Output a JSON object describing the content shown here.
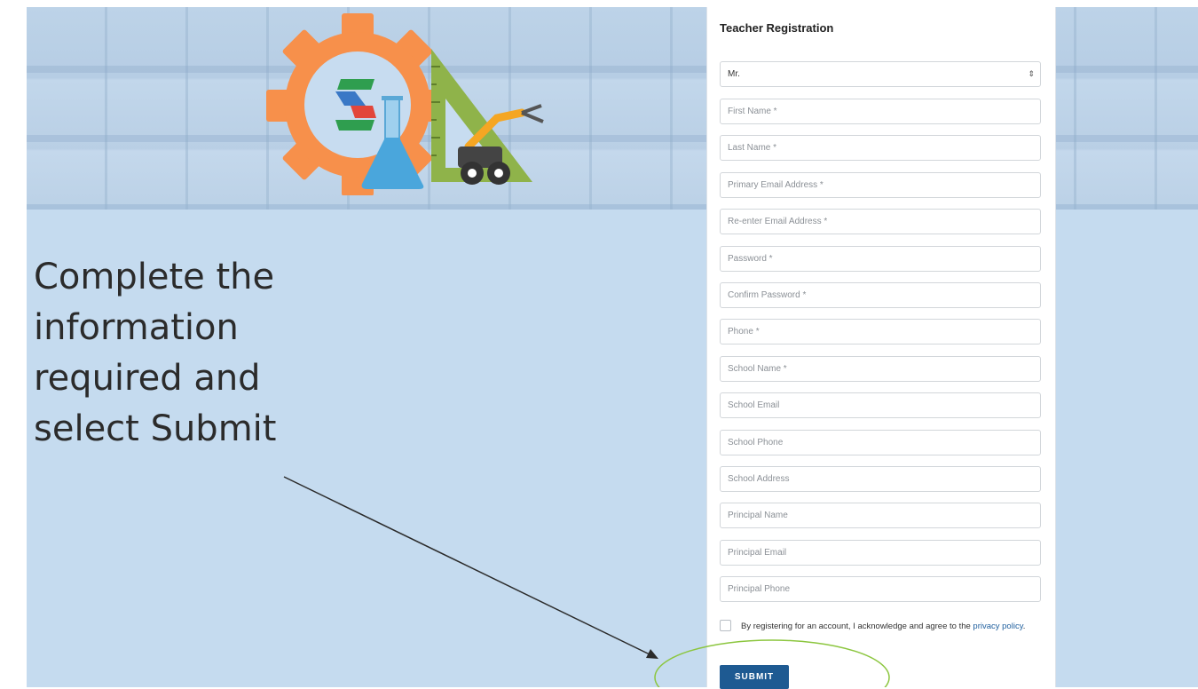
{
  "instruction": {
    "line1": "Complete the",
    "line2": "information",
    "line3": "required and",
    "line4": "select Submit"
  },
  "form": {
    "title": "Teacher Registration",
    "salutation": {
      "selected": "Mr."
    },
    "fields": {
      "first_name": "First Name *",
      "last_name": "Last Name *",
      "primary_email": "Primary Email Address *",
      "reenter_email": "Re-enter Email Address *",
      "password": "Password *",
      "confirm_password": "Confirm Password *",
      "phone": "Phone *",
      "school_name": "School Name *",
      "school_email": "School Email",
      "school_phone": "School Phone",
      "school_address": "School Address",
      "principal_name": "Principal Name",
      "principal_email": "Principal Email",
      "principal_phone": "Principal Phone"
    },
    "consent": {
      "text": "By registering for an account, I acknowledge and agree to the ",
      "link": "privacy policy",
      "end": "."
    },
    "submit_label": "SUBMIT"
  },
  "colors": {
    "page_background": "#c5dbef",
    "submit_button": "#1e5a92",
    "link": "#1f5f9e",
    "highlight_ellipse": "#8cc63f",
    "gear": "#f7904b"
  },
  "icons": [
    "gear-logo-icon",
    "flask-icon",
    "triangle-ruler-icon",
    "robot-arm-icon",
    "select-arrow-icon"
  ]
}
